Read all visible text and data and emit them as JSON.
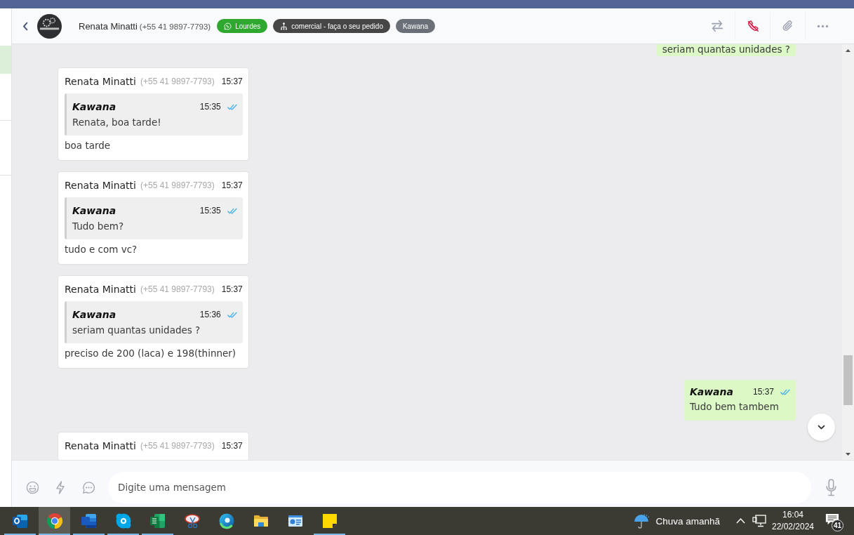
{
  "header": {
    "contact": {
      "name": "Renata Minatti",
      "phone": "(+55 41 9897-7793)"
    },
    "tags": [
      {
        "kind": "channel",
        "label": "Lourdes",
        "color": "#2fa82f"
      },
      {
        "kind": "queue",
        "label": "comercial - faça o seu pedido",
        "color": "#464646"
      },
      {
        "kind": "agent",
        "label": "Kawana",
        "color": "#6b7078"
      }
    ]
  },
  "messages": [
    {
      "kind": "outgoing",
      "text": "seriam quantas unidades ?"
    },
    {
      "kind": "incoming",
      "author": "Renata Minatti",
      "phone": "(+55 41 9897-7793)",
      "time": "15:37",
      "quote": {
        "author": "Kawana",
        "time": "15:35",
        "read": true,
        "text": "Renata, boa tarde!"
      },
      "text": "boa tarde"
    },
    {
      "kind": "incoming",
      "author": "Renata Minatti",
      "phone": "(+55 41 9897-7793)",
      "time": "15:37",
      "quote": {
        "author": "Kawana",
        "time": "15:35",
        "read": true,
        "text": "Tudo bem?"
      },
      "text": "tudo e com vc?"
    },
    {
      "kind": "incoming",
      "author": "Renata Minatti",
      "phone": "(+55 41 9897-7793)",
      "time": "15:37",
      "quote": {
        "author": "Kawana",
        "time": "15:36",
        "read": true,
        "text": "seriam quantas unidades ?"
      },
      "text": "preciso de 200 (laca) e 198(thinner)"
    },
    {
      "kind": "outgoing",
      "author": "Kawana",
      "time": "15:37",
      "read": true,
      "text": "Tudo bem tambem"
    },
    {
      "kind": "incoming",
      "author": "Renata Minatti",
      "phone": "(+55 41 9897-7793)",
      "time": "15:37"
    }
  ],
  "composer": {
    "placeholder": "Digite uma mensagem"
  },
  "taskbar": {
    "apps": [
      {
        "kind": "mail",
        "open": true,
        "selected": false
      },
      {
        "kind": "browser",
        "open": true,
        "selected": true
      },
      {
        "kind": "document",
        "open": true,
        "selected": false
      },
      {
        "kind": "messenger",
        "open": true,
        "selected": false
      },
      {
        "kind": "spreadsheet",
        "open": true,
        "selected": false
      },
      {
        "kind": "scissors",
        "open": false,
        "selected": false
      },
      {
        "kind": "web",
        "open": false,
        "selected": false
      },
      {
        "kind": "folder",
        "open": false,
        "selected": false
      },
      {
        "kind": "panel",
        "open": false,
        "selected": false
      },
      {
        "kind": "note",
        "open": true,
        "selected": false
      }
    ],
    "weather": "Chuva amanhã",
    "time": "16:04",
    "date": "22/02/2024",
    "notifications": "41"
  }
}
